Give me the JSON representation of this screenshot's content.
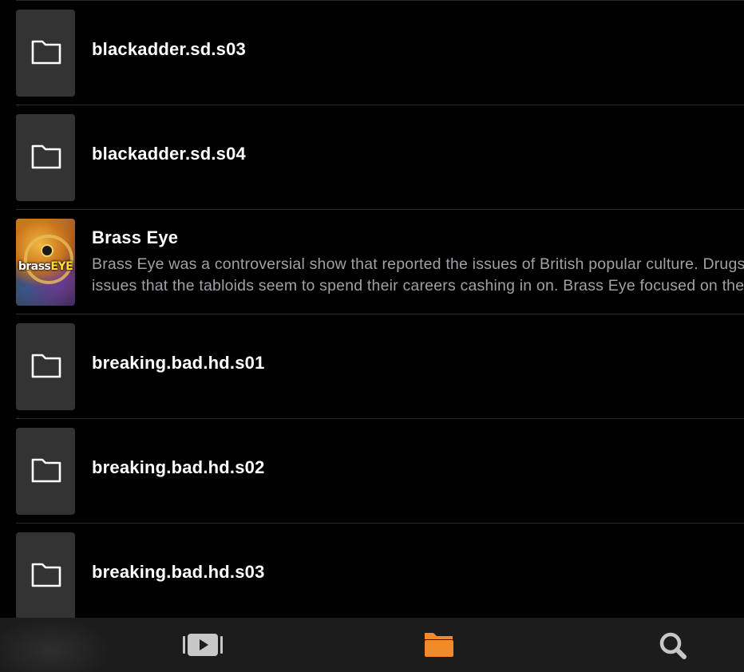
{
  "browser": {
    "rows": [
      {
        "type": "folder",
        "title": "blackadder.sd.s03",
        "icon": "folder-icon"
      },
      {
        "type": "folder",
        "title": "blackadder.sd.s04",
        "icon": "folder-icon"
      },
      {
        "type": "media",
        "title": "Brass Eye",
        "description_line1": "Brass Eye was a controversial show that reported the issues of British popular culture. Drugs,",
        "description_line2": "issues that the tabloids seem to spend their careers cashing in on. Brass Eye focused on the p",
        "poster_logo_a": "brass",
        "poster_logo_b": "EYE"
      },
      {
        "type": "folder",
        "title": "breaking.bad.hd.s01",
        "icon": "folder-icon"
      },
      {
        "type": "folder",
        "title": "breaking.bad.hd.s02",
        "icon": "folder-icon"
      },
      {
        "type": "folder",
        "title": "breaking.bad.hd.s03",
        "icon": "folder-icon"
      }
    ]
  },
  "tabbar": {
    "tabs": [
      {
        "name": "video",
        "icon": "video-library-icon",
        "selected": false
      },
      {
        "name": "files",
        "icon": "folder-filled-icon",
        "selected": true
      },
      {
        "name": "search",
        "icon": "search-icon",
        "selected": false
      }
    ]
  },
  "colors": {
    "background": "#000000",
    "thumbnail": "#333333",
    "divider": "#2c2c2e",
    "title_text": "#ffffff",
    "description_text": "#a0a0a6",
    "tabbar_background": "#1c1c1c",
    "tab_inactive": "#c7c7c7",
    "accent": "#f08a2a"
  }
}
